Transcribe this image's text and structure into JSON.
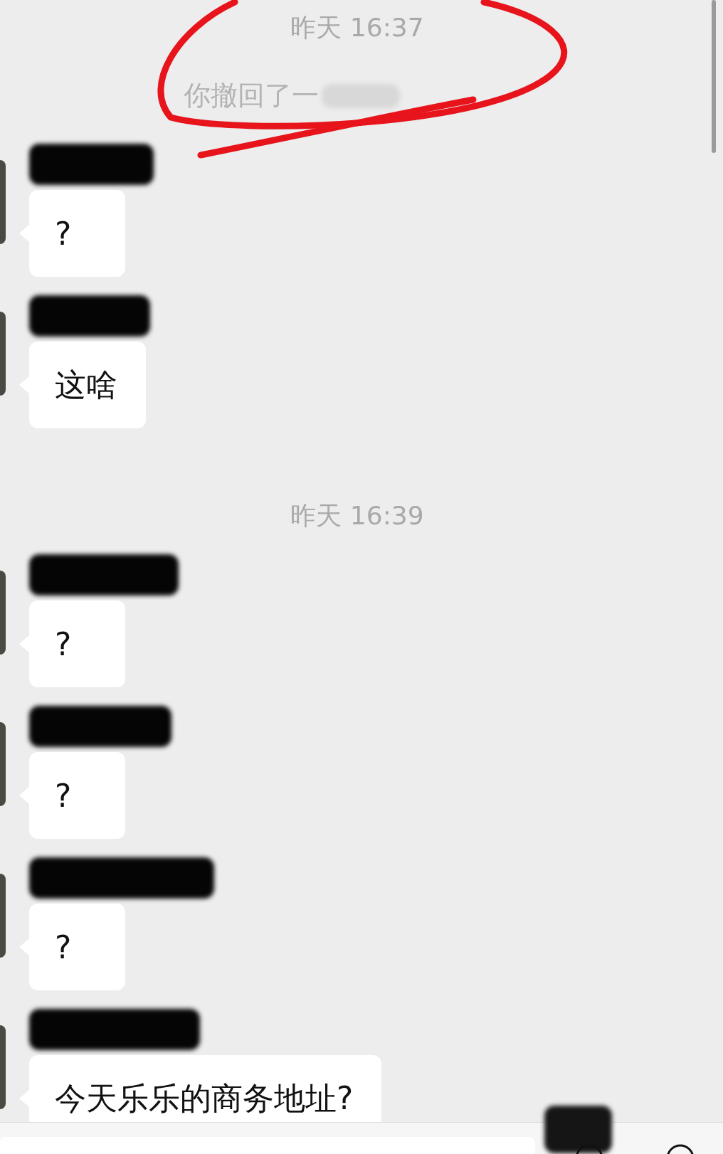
{
  "messages": [
    {
      "kind": "time",
      "text": "昨天 16:37"
    },
    {
      "kind": "recall",
      "text": "你撤回了一"
    },
    {
      "kind": "message",
      "text": "?"
    },
    {
      "kind": "message",
      "text": "这啥"
    },
    {
      "kind": "time",
      "text": "昨天 16:39"
    },
    {
      "kind": "message",
      "text": "?"
    },
    {
      "kind": "message",
      "text": "?"
    },
    {
      "kind": "message",
      "text": "?"
    },
    {
      "kind": "message",
      "text": "今天乐乐的商务地址?"
    }
  ]
}
